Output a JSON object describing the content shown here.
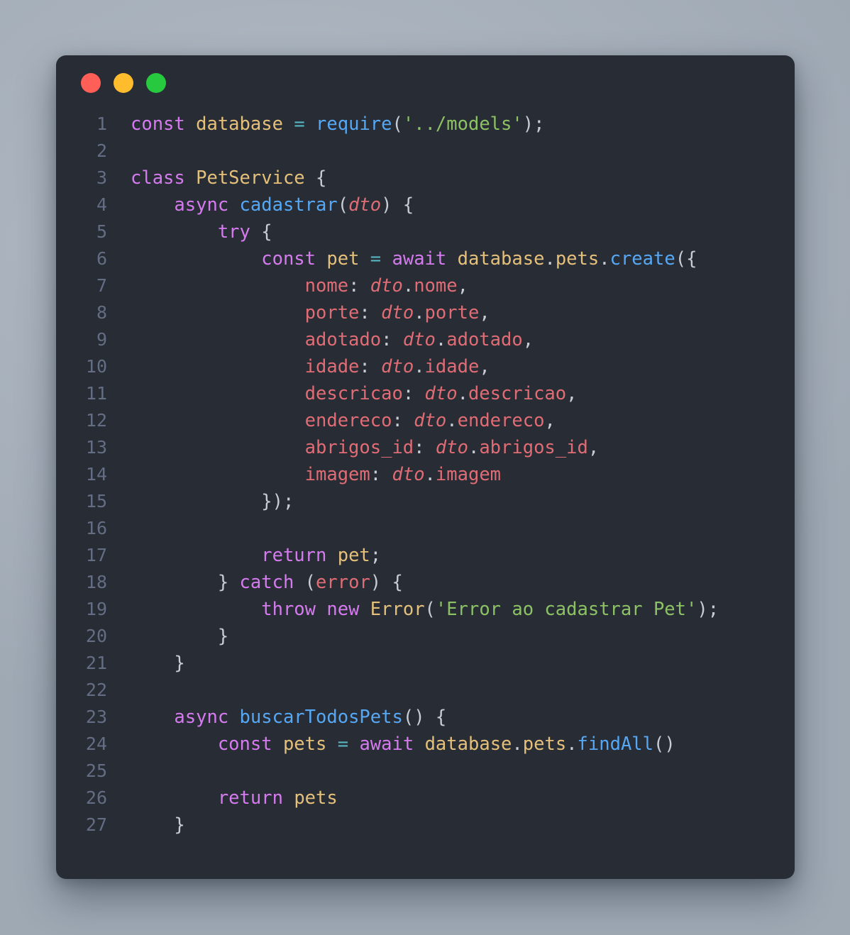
{
  "window": {
    "title": "",
    "traffic_lights": [
      {
        "name": "close-button",
        "color": "#ff5f56",
        "label": ""
      },
      {
        "name": "minimize-button",
        "color": "#ffbd2e",
        "label": ""
      },
      {
        "name": "maximize-button",
        "color": "#27c93f",
        "label": ""
      }
    ],
    "background": "#282c34",
    "page_background": "#aab4be"
  },
  "editor": {
    "language": "javascript",
    "line_number_color": "#636d83",
    "theme_colors": {
      "keyword": "#d57bef",
      "variable": "#e5c07b",
      "function": "#56a8f5",
      "string": "#8cc265",
      "property": "#e06c75",
      "parameter": "#e06c75",
      "operator": "#56b6c2",
      "punctuation": "#c8ccd4"
    },
    "code_text": "const database = require('../models');\n\nclass PetService {\n    async cadastrar(dto) {\n        try {\n            const pet = await database.pets.create({\n                nome: dto.nome,\n                porte: dto.porte,\n                adotado: dto.adotado,\n                idade: dto.idade,\n                descricao: dto.descricao,\n                endereco: dto.endereco,\n                abrigos_id: dto.abrigos_id,\n                imagem: dto.imagem\n            });\n\n            return pet;\n        } catch (error) {\n            throw new Error('Error ao cadastrar Pet');\n        }\n    }\n\n    async buscarTodosPets() {\n        const pets = await database.pets.findAll()\n\n        return pets\n    }",
    "lines": [
      {
        "n": "1",
        "tokens": [
          {
            "t": "const",
            "c": "kw"
          },
          {
            "t": " ",
            "c": "plain"
          },
          {
            "t": "database",
            "c": "var"
          },
          {
            "t": " ",
            "c": "plain"
          },
          {
            "t": "=",
            "c": "op"
          },
          {
            "t": " ",
            "c": "plain"
          },
          {
            "t": "require",
            "c": "fn"
          },
          {
            "t": "(",
            "c": "punc"
          },
          {
            "t": "'../models'",
            "c": "str"
          },
          {
            "t": ");",
            "c": "punc"
          }
        ]
      },
      {
        "n": "2",
        "tokens": []
      },
      {
        "n": "3",
        "tokens": [
          {
            "t": "class",
            "c": "kw"
          },
          {
            "t": " ",
            "c": "plain"
          },
          {
            "t": "PetService",
            "c": "var"
          },
          {
            "t": " ",
            "c": "plain"
          },
          {
            "t": "{",
            "c": "punc"
          }
        ]
      },
      {
        "n": "4",
        "tokens": [
          {
            "t": "    ",
            "c": "plain"
          },
          {
            "t": "async",
            "c": "kw"
          },
          {
            "t": " ",
            "c": "plain"
          },
          {
            "t": "cadastrar",
            "c": "fn"
          },
          {
            "t": "(",
            "c": "punc"
          },
          {
            "t": "dto",
            "c": "param"
          },
          {
            "t": ") ",
            "c": "punc"
          },
          {
            "t": "{",
            "c": "punc"
          }
        ]
      },
      {
        "n": "5",
        "tokens": [
          {
            "t": "        ",
            "c": "plain"
          },
          {
            "t": "try",
            "c": "kw"
          },
          {
            "t": " ",
            "c": "plain"
          },
          {
            "t": "{",
            "c": "punc"
          }
        ]
      },
      {
        "n": "6",
        "tokens": [
          {
            "t": "            ",
            "c": "plain"
          },
          {
            "t": "const",
            "c": "kw"
          },
          {
            "t": " ",
            "c": "plain"
          },
          {
            "t": "pet",
            "c": "var"
          },
          {
            "t": " ",
            "c": "plain"
          },
          {
            "t": "=",
            "c": "op"
          },
          {
            "t": " ",
            "c": "plain"
          },
          {
            "t": "await",
            "c": "kw"
          },
          {
            "t": " ",
            "c": "plain"
          },
          {
            "t": "database",
            "c": "var"
          },
          {
            "t": ".",
            "c": "punc"
          },
          {
            "t": "pets",
            "c": "var"
          },
          {
            "t": ".",
            "c": "punc"
          },
          {
            "t": "create",
            "c": "fn"
          },
          {
            "t": "({",
            "c": "punc"
          }
        ]
      },
      {
        "n": "7",
        "tokens": [
          {
            "t": "                ",
            "c": "plain"
          },
          {
            "t": "nome",
            "c": "prop"
          },
          {
            "t": ": ",
            "c": "punc"
          },
          {
            "t": "dto",
            "c": "param"
          },
          {
            "t": ".",
            "c": "punc"
          },
          {
            "t": "nome",
            "c": "prop"
          },
          {
            "t": ",",
            "c": "punc"
          }
        ]
      },
      {
        "n": "8",
        "tokens": [
          {
            "t": "                ",
            "c": "plain"
          },
          {
            "t": "porte",
            "c": "prop"
          },
          {
            "t": ": ",
            "c": "punc"
          },
          {
            "t": "dto",
            "c": "param"
          },
          {
            "t": ".",
            "c": "punc"
          },
          {
            "t": "porte",
            "c": "prop"
          },
          {
            "t": ",",
            "c": "punc"
          }
        ]
      },
      {
        "n": "9",
        "tokens": [
          {
            "t": "                ",
            "c": "plain"
          },
          {
            "t": "adotado",
            "c": "prop"
          },
          {
            "t": ": ",
            "c": "punc"
          },
          {
            "t": "dto",
            "c": "param"
          },
          {
            "t": ".",
            "c": "punc"
          },
          {
            "t": "adotado",
            "c": "prop"
          },
          {
            "t": ",",
            "c": "punc"
          }
        ]
      },
      {
        "n": "10",
        "tokens": [
          {
            "t": "                ",
            "c": "plain"
          },
          {
            "t": "idade",
            "c": "prop"
          },
          {
            "t": ": ",
            "c": "punc"
          },
          {
            "t": "dto",
            "c": "param"
          },
          {
            "t": ".",
            "c": "punc"
          },
          {
            "t": "idade",
            "c": "prop"
          },
          {
            "t": ",",
            "c": "punc"
          }
        ]
      },
      {
        "n": "11",
        "tokens": [
          {
            "t": "                ",
            "c": "plain"
          },
          {
            "t": "descricao",
            "c": "prop"
          },
          {
            "t": ": ",
            "c": "punc"
          },
          {
            "t": "dto",
            "c": "param"
          },
          {
            "t": ".",
            "c": "punc"
          },
          {
            "t": "descricao",
            "c": "prop"
          },
          {
            "t": ",",
            "c": "punc"
          }
        ]
      },
      {
        "n": "12",
        "tokens": [
          {
            "t": "                ",
            "c": "plain"
          },
          {
            "t": "endereco",
            "c": "prop"
          },
          {
            "t": ": ",
            "c": "punc"
          },
          {
            "t": "dto",
            "c": "param"
          },
          {
            "t": ".",
            "c": "punc"
          },
          {
            "t": "endereco",
            "c": "prop"
          },
          {
            "t": ",",
            "c": "punc"
          }
        ]
      },
      {
        "n": "13",
        "tokens": [
          {
            "t": "                ",
            "c": "plain"
          },
          {
            "t": "abrigos_id",
            "c": "prop"
          },
          {
            "t": ": ",
            "c": "punc"
          },
          {
            "t": "dto",
            "c": "param"
          },
          {
            "t": ".",
            "c": "punc"
          },
          {
            "t": "abrigos_id",
            "c": "prop"
          },
          {
            "t": ",",
            "c": "punc"
          }
        ]
      },
      {
        "n": "14",
        "tokens": [
          {
            "t": "                ",
            "c": "plain"
          },
          {
            "t": "imagem",
            "c": "prop"
          },
          {
            "t": ": ",
            "c": "punc"
          },
          {
            "t": "dto",
            "c": "param"
          },
          {
            "t": ".",
            "c": "punc"
          },
          {
            "t": "imagem",
            "c": "prop"
          }
        ]
      },
      {
        "n": "15",
        "tokens": [
          {
            "t": "            ",
            "c": "plain"
          },
          {
            "t": "});",
            "c": "punc"
          }
        ]
      },
      {
        "n": "16",
        "tokens": []
      },
      {
        "n": "17",
        "tokens": [
          {
            "t": "            ",
            "c": "plain"
          },
          {
            "t": "return",
            "c": "kw"
          },
          {
            "t": " ",
            "c": "plain"
          },
          {
            "t": "pet",
            "c": "var"
          },
          {
            "t": ";",
            "c": "punc"
          }
        ]
      },
      {
        "n": "18",
        "tokens": [
          {
            "t": "        ",
            "c": "plain"
          },
          {
            "t": "}",
            "c": "punc"
          },
          {
            "t": " ",
            "c": "plain"
          },
          {
            "t": "catch",
            "c": "kw"
          },
          {
            "t": " ",
            "c": "plain"
          },
          {
            "t": "(",
            "c": "punc"
          },
          {
            "t": "error",
            "c": "prop"
          },
          {
            "t": ") ",
            "c": "punc"
          },
          {
            "t": "{",
            "c": "punc"
          }
        ]
      },
      {
        "n": "19",
        "tokens": [
          {
            "t": "            ",
            "c": "plain"
          },
          {
            "t": "throw",
            "c": "kw"
          },
          {
            "t": " ",
            "c": "plain"
          },
          {
            "t": "new",
            "c": "kw"
          },
          {
            "t": " ",
            "c": "plain"
          },
          {
            "t": "Error",
            "c": "var"
          },
          {
            "t": "(",
            "c": "punc"
          },
          {
            "t": "'Error ao cadastrar Pet'",
            "c": "str"
          },
          {
            "t": ");",
            "c": "punc"
          }
        ]
      },
      {
        "n": "20",
        "tokens": [
          {
            "t": "        ",
            "c": "plain"
          },
          {
            "t": "}",
            "c": "punc"
          }
        ]
      },
      {
        "n": "21",
        "tokens": [
          {
            "t": "    ",
            "c": "plain"
          },
          {
            "t": "}",
            "c": "punc"
          }
        ]
      },
      {
        "n": "22",
        "tokens": []
      },
      {
        "n": "23",
        "tokens": [
          {
            "t": "    ",
            "c": "plain"
          },
          {
            "t": "async",
            "c": "kw"
          },
          {
            "t": " ",
            "c": "plain"
          },
          {
            "t": "buscarTodosPets",
            "c": "fn"
          },
          {
            "t": "() ",
            "c": "punc"
          },
          {
            "t": "{",
            "c": "punc"
          }
        ]
      },
      {
        "n": "24",
        "tokens": [
          {
            "t": "        ",
            "c": "plain"
          },
          {
            "t": "const",
            "c": "kw"
          },
          {
            "t": " ",
            "c": "plain"
          },
          {
            "t": "pets",
            "c": "var"
          },
          {
            "t": " ",
            "c": "plain"
          },
          {
            "t": "=",
            "c": "op"
          },
          {
            "t": " ",
            "c": "plain"
          },
          {
            "t": "await",
            "c": "kw"
          },
          {
            "t": " ",
            "c": "plain"
          },
          {
            "t": "database",
            "c": "var"
          },
          {
            "t": ".",
            "c": "punc"
          },
          {
            "t": "pets",
            "c": "var"
          },
          {
            "t": ".",
            "c": "punc"
          },
          {
            "t": "findAll",
            "c": "fn"
          },
          {
            "t": "()",
            "c": "punc"
          }
        ]
      },
      {
        "n": "25",
        "tokens": []
      },
      {
        "n": "26",
        "tokens": [
          {
            "t": "        ",
            "c": "plain"
          },
          {
            "t": "return",
            "c": "kw"
          },
          {
            "t": " ",
            "c": "plain"
          },
          {
            "t": "pets",
            "c": "var"
          }
        ]
      },
      {
        "n": "27",
        "tokens": [
          {
            "t": "    ",
            "c": "plain"
          },
          {
            "t": "}",
            "c": "punc"
          }
        ]
      }
    ]
  }
}
